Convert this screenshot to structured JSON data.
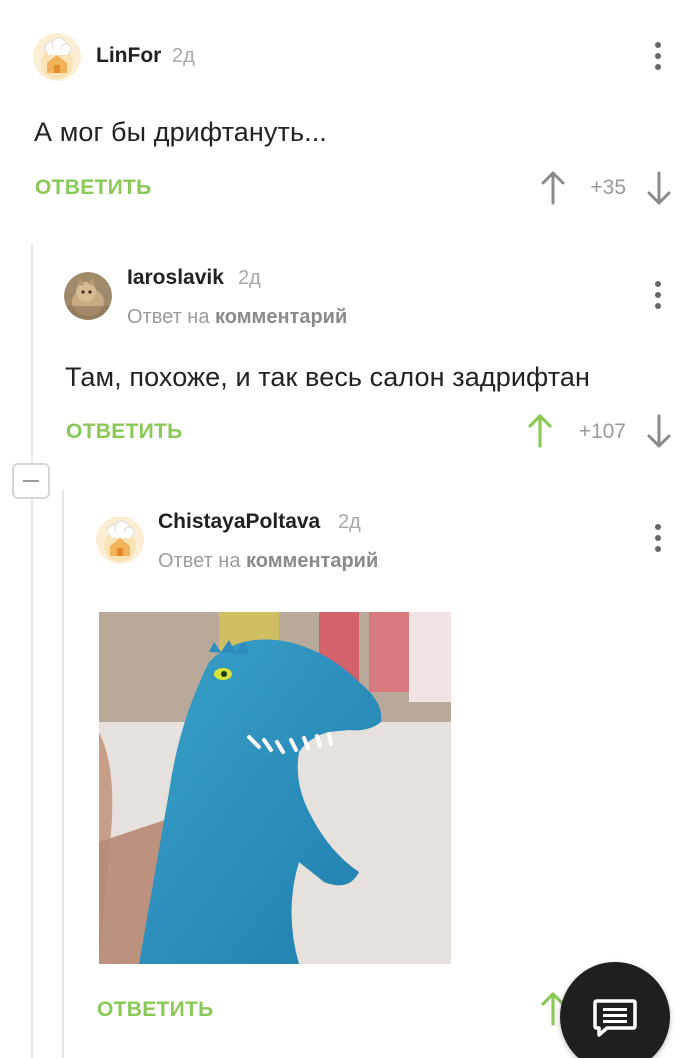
{
  "comments": [
    {
      "username": "LinFor",
      "age": "2д",
      "text": "А мог бы дрифтануть...",
      "reply_label": "ОТВЕТИТЬ",
      "rating": "+35",
      "avatar_icon": "chef-hat-house-avatar"
    },
    {
      "username": "Iaroslavik",
      "age": "2д",
      "reply_prefix": "Ответ на",
      "reply_target": "комментарий",
      "text": "Там, похоже, и так весь салон задрифтан",
      "reply_label": "ОТВЕТИТЬ",
      "rating": "+107",
      "upvoted": true,
      "avatar_icon": "cat-photo-avatar"
    },
    {
      "username": "ChistayaPoltava",
      "age": "2д",
      "reply_prefix": "Ответ на",
      "reply_target": "комментарий",
      "image": "blue-toy-dinosaur-photo",
      "reply_label": "ОТВЕТИТЬ",
      "avatar_icon": "chef-hat-house-avatar"
    }
  ],
  "colors": {
    "accent_green": "#8ac858",
    "text": "#222222",
    "muted": "#9c9c9c",
    "fab_bg": "#1f1f1f"
  },
  "fab_icon": "comment-icon",
  "collapse_icon": "minus-icon"
}
